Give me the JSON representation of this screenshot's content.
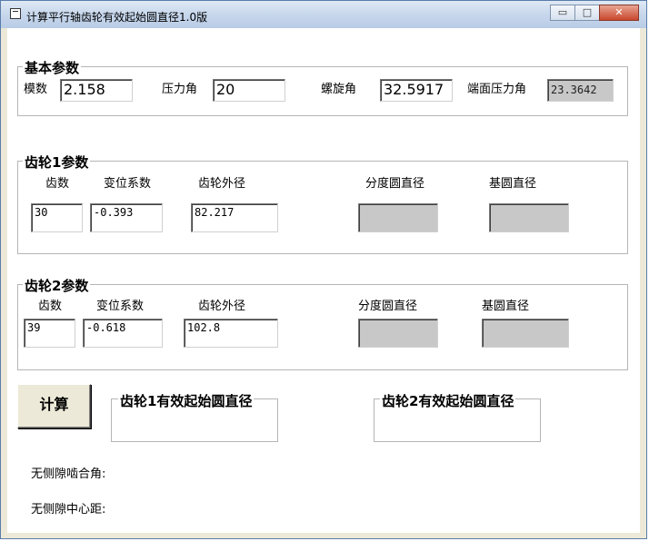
{
  "window": {
    "title": "计算平行轴齿轮有效起始圆直径1.0版",
    "min_glyph": "▭",
    "max_glyph": "□",
    "close_glyph": "✕"
  },
  "basic": {
    "legend": "基本参数",
    "module_label": "模数",
    "module_value": "2.158",
    "pressure_angle_label": "压力角",
    "pressure_angle_value": "20",
    "helix_angle_label": "螺旋角",
    "helix_angle_value": "32.5917",
    "transverse_pressure_label": "端面压力角",
    "transverse_pressure_value": "23.3642"
  },
  "gear1": {
    "legend": "齿轮1参数",
    "teeth_label": "齿数",
    "shift_label": "变位系数",
    "outer_dia_label": "齿轮外径",
    "pitch_dia_label": "分度圆直径",
    "base_dia_label": "基圆直径",
    "teeth_value": "30",
    "shift_value": "-0.393",
    "outer_dia_value": "82.217",
    "pitch_dia_value": "",
    "base_dia_value": ""
  },
  "gear2": {
    "legend": "齿轮2参数",
    "teeth_label": "齿数",
    "shift_label": "变位系数",
    "outer_dia_label": "齿轮外径",
    "pitch_dia_label": "分度圆直径",
    "base_dia_label": "基圆直径",
    "teeth_value": "39",
    "shift_value": "-0.618",
    "outer_dia_value": "102.8",
    "pitch_dia_value": "",
    "base_dia_value": ""
  },
  "calc_button": "计算",
  "results": {
    "gear1_title": "齿轮1有效起始圆直径",
    "gear2_title": "齿轮2有效起始圆直径"
  },
  "footer": {
    "backlash_free_angle_label": "无侧隙啮合角:",
    "backlash_free_center_label": "无侧隙中心距:"
  }
}
